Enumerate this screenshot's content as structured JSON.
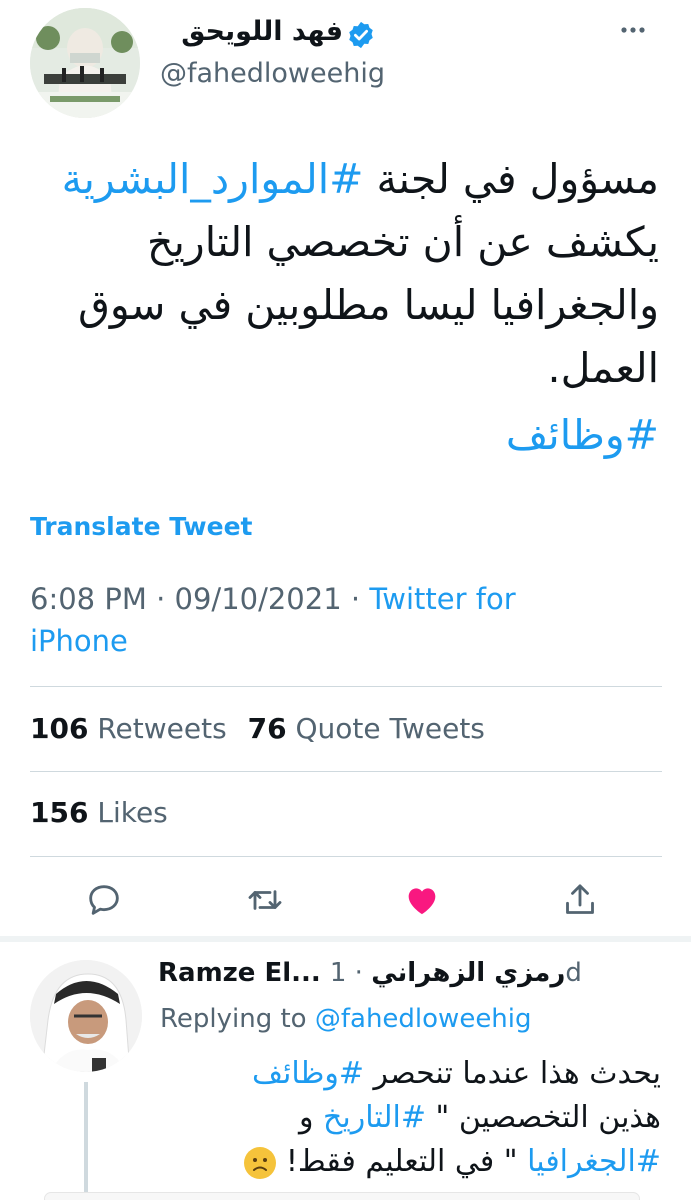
{
  "tweet": {
    "author_name": "فهد اللويحق",
    "author_handle": "@fahedloweehig",
    "text_lines": [
      {
        "pre": "مسؤول في لجنة ",
        "hashtag": "#الموارد_البشرية",
        "post": ""
      },
      {
        "pre": "يكشف عن أن تخصصي التاريخ",
        "hashtag": "",
        "post": ""
      },
      {
        "pre": "والجغرافيا ليسا مطلوبين في سوق",
        "hashtag": "",
        "post": ""
      },
      {
        "pre": "العمل.",
        "hashtag": "",
        "post": ""
      }
    ],
    "hashtag_line": "#وظائف",
    "translate_label": "Translate Tweet",
    "time": "6:08 PM",
    "date": "09/10/2021",
    "separator": "·",
    "source_line1": "Twitter for",
    "source_line2": "iPhone",
    "retweets_count": "106",
    "retweets_label": "Retweets",
    "quotes_count": "76",
    "quotes_label": "Quote Tweets",
    "likes_count": "156",
    "likes_label": "Likes"
  },
  "reply": {
    "name": "Ramze El... رمزي الزهراني",
    "separator": "·",
    "time": "1d",
    "replying_label": "Replying to",
    "replying_handle": "@fahedloweehig",
    "line1_pre": "يحدث هذا عندما تنحصر ",
    "line1_tag": "#وظائف",
    "line2_pre": "هذين التخصصين \" ",
    "line2_tag": "#التاريخ",
    "line2_post": " و",
    "line3_tag": "#الجغرافيا",
    "line3_post": " \" في التعليم فقط!"
  },
  "colors": {
    "accent": "#1d9bf0",
    "like": "#f91880",
    "secondary_text": "#536471",
    "divider": "#cfd9de"
  },
  "icons": {
    "verified": "verified-badge-icon",
    "more": "more-horizontal-icon",
    "reply": "reply-icon",
    "retweet": "retweet-icon",
    "like": "heart-filled-icon",
    "share": "share-icon",
    "emoji": "frowning-face-emoji"
  }
}
